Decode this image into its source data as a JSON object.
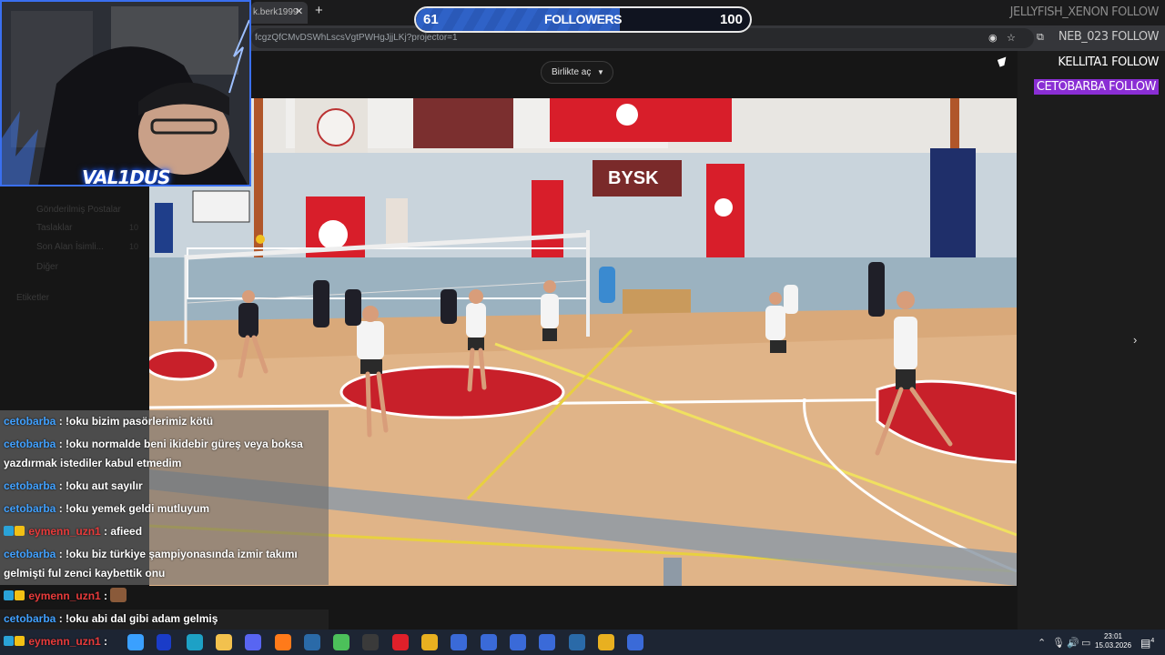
{
  "browser": {
    "tab_title": "k.berk1999",
    "url": "fcgzQfCMvDSWhLscsVgtPWHgJjjLKj?projector=1"
  },
  "page": {
    "together_button": "Birlikte aç",
    "sidebar": [
      {
        "label": "Gönderilmiş Postalar",
        "count": ""
      },
      {
        "label": "Taslaklar",
        "count": "10"
      },
      {
        "label": "Son Alan İsimli...",
        "count": "10"
      },
      {
        "label": "Diğer",
        "count": ""
      },
      {
        "label": "Etiketler",
        "count": ""
      }
    ]
  },
  "overlay": {
    "webcam_name": "VAL1DUS",
    "followers": {
      "current": "61",
      "label": "FOLLOWERS",
      "goal": "100",
      "progress": 0.61
    },
    "alerts": [
      {
        "text": "JELLYFISH_XENON  FOLLOW"
      },
      {
        "text": "NEB_023  FOLLOW"
      },
      {
        "text": "KELLITA1  FOLLOW"
      },
      {
        "text": "CETOBARBA FOLLOW"
      }
    ],
    "banner_text": "BYSK"
  },
  "chat": [
    {
      "user": "cetobarba",
      "color": "blue",
      "badges": false,
      "message": ": !oku bizim pasörlerimiz kötü"
    },
    {
      "user": "cetobarba",
      "color": "blue",
      "badges": false,
      "message": ": !oku normalde beni ikidebir güreş veya boksa yazdırmak istediler kabul etmedim"
    },
    {
      "user": "cetobarba",
      "color": "blue",
      "badges": false,
      "message": ": !oku aut sayılır"
    },
    {
      "user": "cetobarba",
      "color": "blue",
      "badges": false,
      "message": ": !oku yemek geldi mutluyum"
    },
    {
      "user": "eymenn_uzn1",
      "color": "red",
      "badges": true,
      "message": ": afieed"
    },
    {
      "user": "cetobarba",
      "color": "blue",
      "badges": false,
      "message": ": !oku biz türkiye şampiyonasında izmir takımı gelmişti ful zenci kaybettik onu"
    },
    {
      "user": "eymenn_uzn1",
      "color": "red",
      "badges": true,
      "message": ":"
    },
    {
      "user": "cetobarba",
      "color": "blue",
      "badges": false,
      "message": ": !oku abi dal gibi adam gelmiş"
    },
    {
      "user": "eymenn_uzn1",
      "color": "red",
      "badges": true,
      "message": ":"
    }
  ],
  "taskbar": {
    "time": "23:01",
    "date": "15.03.2026",
    "notifications": "4",
    "icons": [
      "start-icon",
      "search-icon",
      "edge-icon",
      "file-explorer-icon",
      "discord-icon",
      "firefox-icon",
      "steam-icon",
      "vpn-icon",
      "obs-icon",
      "opera-icon",
      "chrome-icon",
      "app-icon",
      "app-icon",
      "app-icon",
      "app-icon",
      "steam-icon",
      "chrome-icon",
      "app-icon"
    ]
  }
}
